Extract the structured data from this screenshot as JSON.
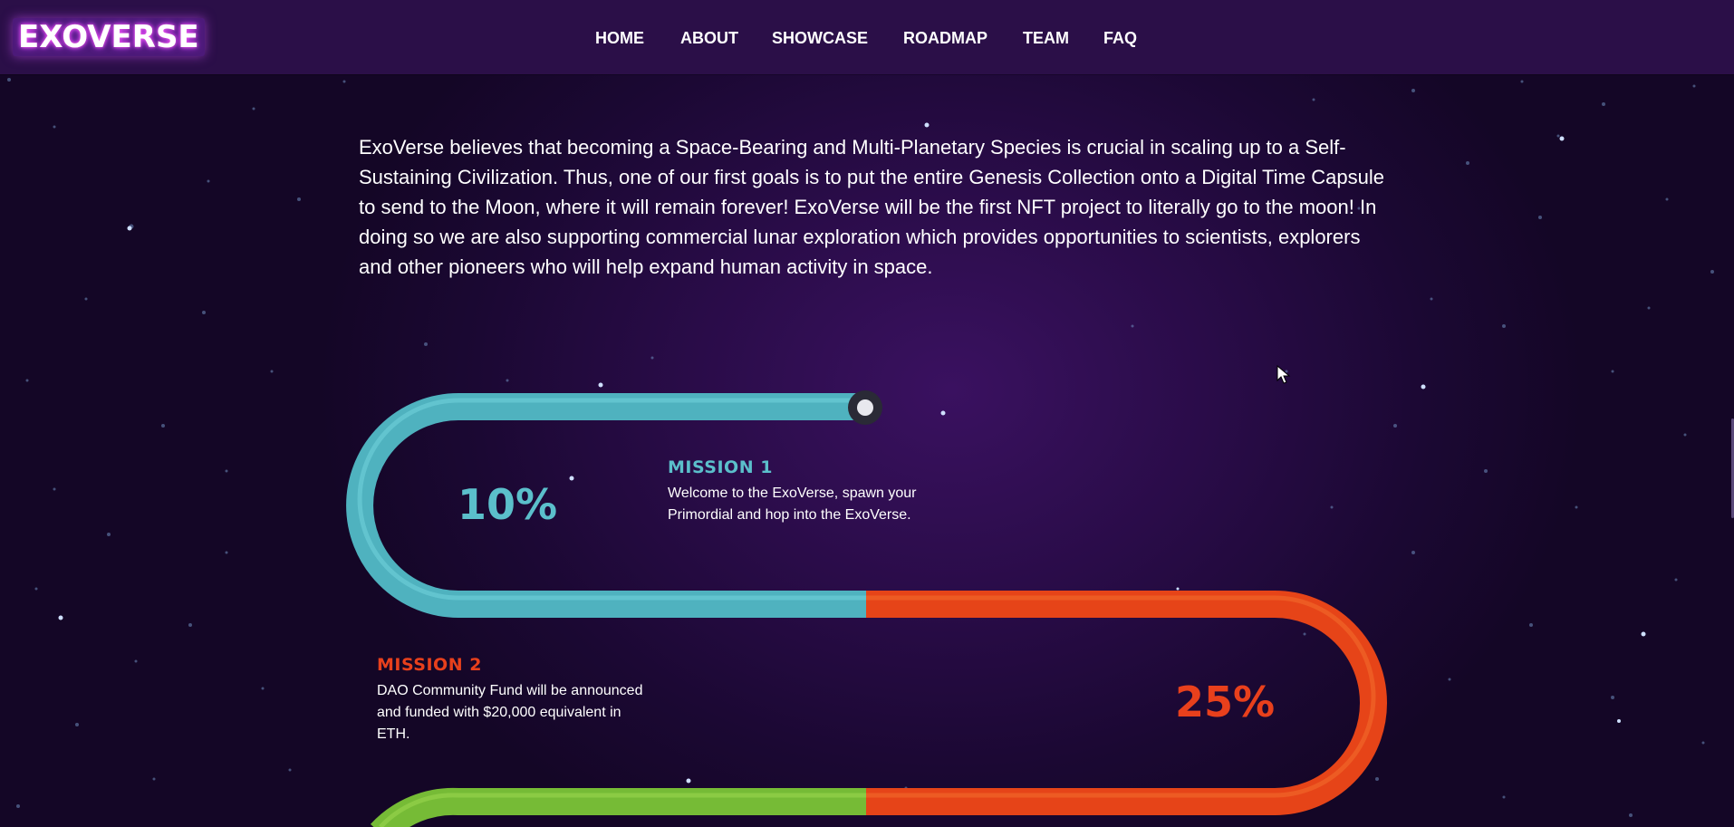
{
  "brand": {
    "logo_text": "EXOVERSE",
    "accent": "#c63bff"
  },
  "nav": {
    "items": [
      {
        "label": "HOME"
      },
      {
        "label": "ABOUT"
      },
      {
        "label": "SHOWCASE"
      },
      {
        "label": "ROADMAP"
      },
      {
        "label": "TEAM"
      },
      {
        "label": "FAQ"
      }
    ]
  },
  "intro": {
    "text": "ExoVerse believes that becoming a Space-Bearing and Multi-Planetary Species is crucial in scaling up to a Self-Sustaining Civilization. Thus, one of our first goals is to put the entire Genesis Collection onto a Digital Time Capsule to send to the Moon, where it will remain forever! ExoVerse will be the first NFT project to literally go to the moon!  In doing so we are also supporting commercial lunar exploration which provides opportunities to scientists, explorers and other pioneers who will help expand human activity in space."
  },
  "roadmap": {
    "missions": [
      {
        "title": "MISSION 1",
        "percent": "10%",
        "description": "Welcome to the ExoVerse, spawn your Primordial and hop into the ExoVerse.",
        "color": "#5bbfcb"
      },
      {
        "title": "MISSION 2",
        "percent": "25%",
        "description": "DAO Community Fund will be announced and funded with $20,000 equivalent in ETH.",
        "color": "#e8401c"
      },
      {
        "color": "#7fc23a"
      }
    ]
  }
}
